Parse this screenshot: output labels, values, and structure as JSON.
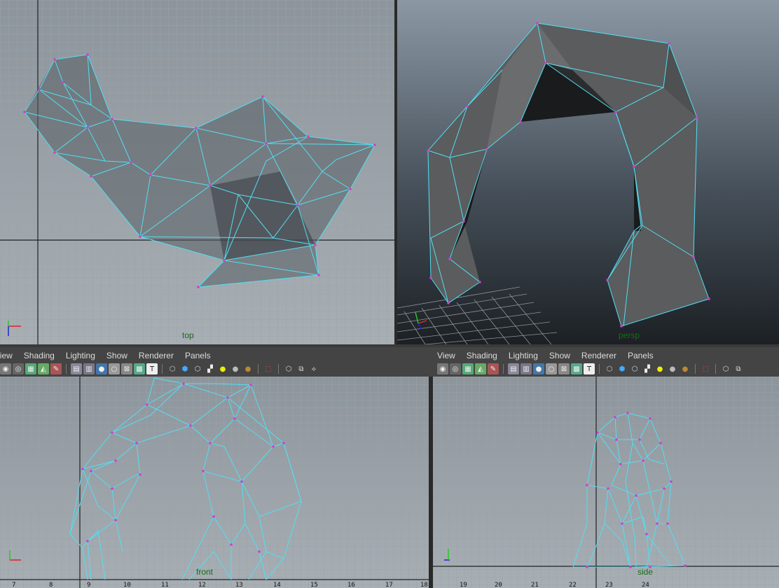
{
  "viewports": {
    "top_left": {
      "camera": "top"
    },
    "top_right": {
      "camera": "persp"
    },
    "bottom_left": {
      "camera": "front"
    },
    "bottom_right": {
      "camera": "side"
    }
  },
  "panel_menu": {
    "left": [
      "View",
      "Shading",
      "Lighting",
      "Show",
      "Renderer",
      "Panels"
    ],
    "right": [
      "View",
      "Shading",
      "Lighting",
      "Show",
      "Renderer",
      "Panels"
    ]
  },
  "toolbar_icons": [
    "camera-select-icon",
    "camera-attr-icon",
    "bookmark-icon",
    "image-plane-icon",
    "2d-pan-zoom-icon",
    "grease-pencil-icon",
    "grid-icon",
    "film-gate-icon",
    "resolution-gate-icon",
    "gate-mask-icon",
    "field-chart-icon",
    "safe-action-icon",
    "wireframe-icon",
    "smooth-shade-icon",
    "default-material-icon",
    "textured-icon",
    "use-lights-icon",
    "shadows-icon",
    "ambient-occlusion-icon",
    "isolate-select-icon",
    "xray-icon",
    "xray-joints-icon",
    "screen-space-icon"
  ],
  "colors": {
    "wire": "#52dff2",
    "vertex": "#d23ad8",
    "grid_line": "#9aa3aa",
    "ortho_bg_top": "#8d959c",
    "ortho_bg_bottom": "#a8afb4",
    "persp_bg_top": "#8b98a4",
    "persp_bg_bottom": "#1c2024",
    "camera_label": "#1a6a1a"
  },
  "ruler_numbers": {
    "bottom_left": [
      "7",
      "8",
      "9",
      "10",
      "11",
      "12",
      "13",
      "14",
      "15",
      "16",
      "17",
      "18"
    ],
    "bottom_right": [
      "19",
      "20",
      "21",
      "22",
      "23",
      "24"
    ]
  }
}
